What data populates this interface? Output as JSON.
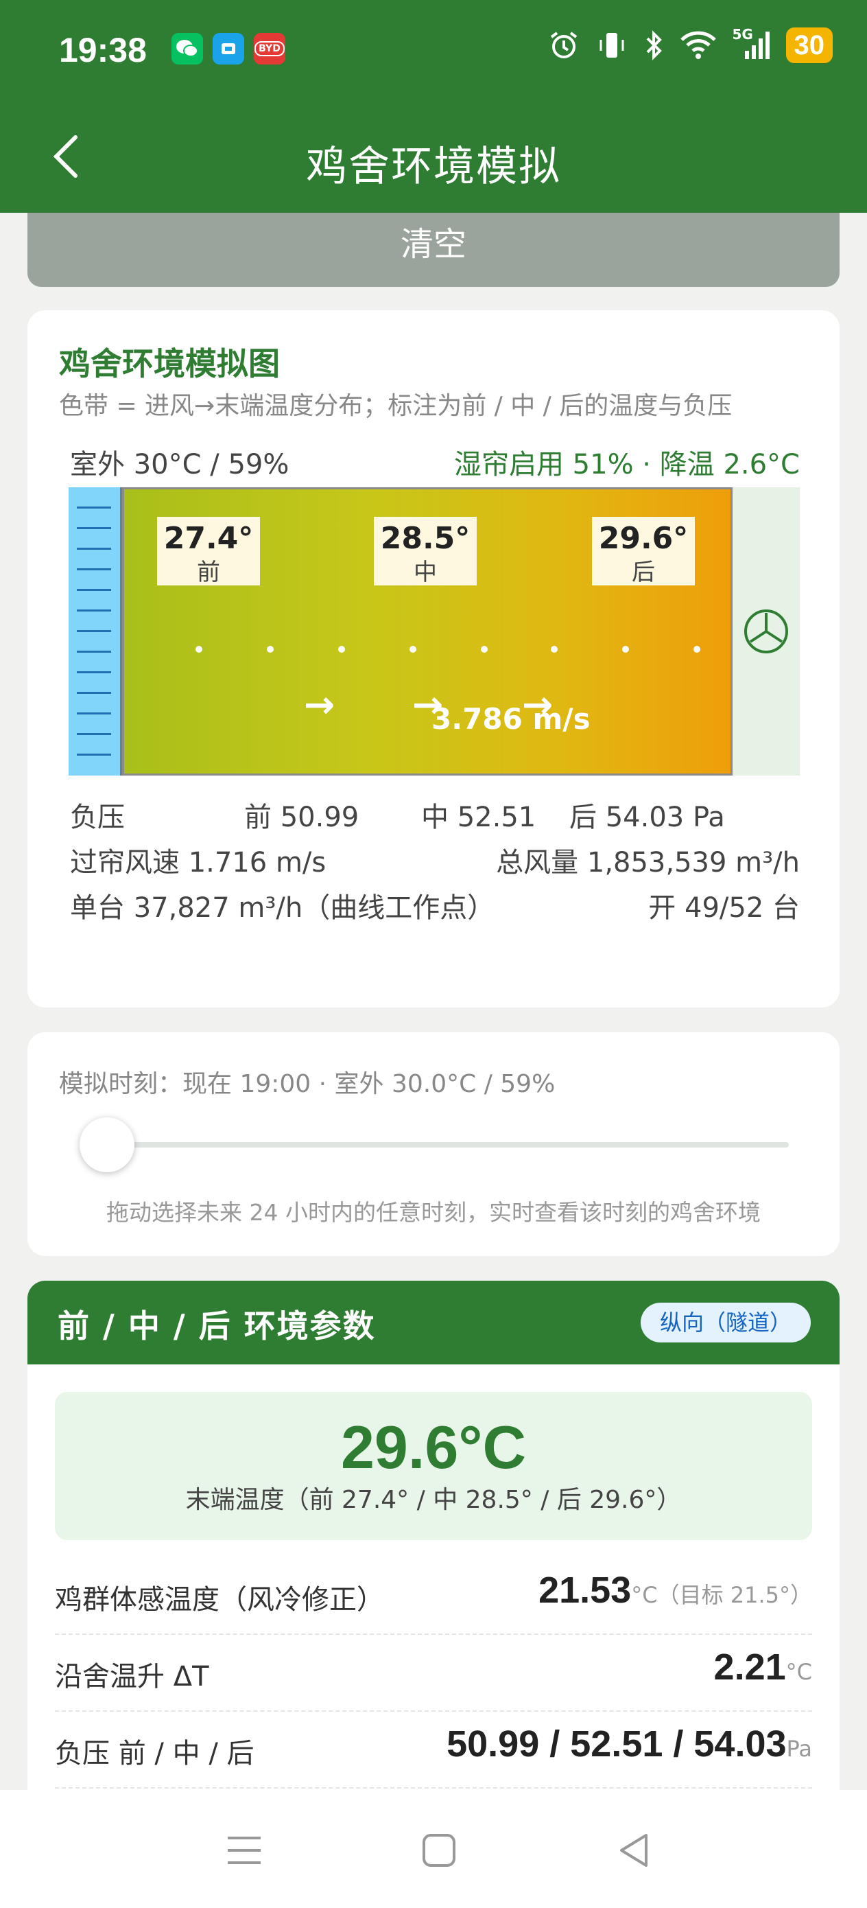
{
  "status_bar": {
    "time": "19:38",
    "network": "5G",
    "battery": "30",
    "app_icon_3": "BYD"
  },
  "nav": {
    "title": "鸡舍环境模拟"
  },
  "clear_button": "清空",
  "sim_card": {
    "title": "鸡舍环境模拟图",
    "subtitle": "色带 = 进风→末端温度分布；标注为前 / 中 / 后的温度与负压",
    "outside": "室外 30°C / 59%",
    "pad_status": "湿帘启用 51% · 降温 2.6°C",
    "tags": [
      {
        "temp": "27.4°",
        "label": "前"
      },
      {
        "temp": "28.5°",
        "label": "中"
      },
      {
        "temp": "29.6°",
        "label": "后"
      }
    ],
    "air_speed": "3.786 m/s",
    "pressure_label": "负压",
    "pressure_front": "前 50.99",
    "pressure_mid": "中 52.51",
    "pressure_back": "后 54.03 Pa",
    "curtain_speed": "过帘风速 1.716 m/s",
    "total_air": "总风量 1,853,539 m³/h",
    "per_fan": "单台 37,827 m³/h（曲线工作点）",
    "fans_on": "开 49/52 台"
  },
  "time_card": {
    "sim_time": "模拟时刻：现在 19:00 · 室外 30.0°C / 59%",
    "slider_hours_offset": 0,
    "hint": "拖动选择未来 24 小时内的任意时刻，实时查看该时刻的鸡舍环境"
  },
  "params_card": {
    "title": "前 / 中 / 后 环境参数",
    "mode": "纵向（隧道）",
    "end_temp": "29.6°C",
    "end_temp_sub": "末端温度（前 27.4° / 中 28.5° / 后 29.6°）",
    "rows": [
      {
        "label": "鸡群体感温度（风冷修正）",
        "value": "21.53",
        "unit": "°C（目标 21.5°）"
      },
      {
        "label": "沿舍温升 ΔT",
        "value": "2.21",
        "unit": "°C"
      },
      {
        "label": "负压 前 / 中 / 后",
        "value": "50.99 / 52.51 / 54.03",
        "unit": "Pa"
      }
    ]
  },
  "colors": {
    "primary": "#2e7d32",
    "pad": "#81d4fa",
    "gradient_start": "#a9bf1a",
    "gradient_end": "#ef9e0a",
    "pill_bg": "#e3f2fd",
    "pill_text": "#1565c0"
  }
}
